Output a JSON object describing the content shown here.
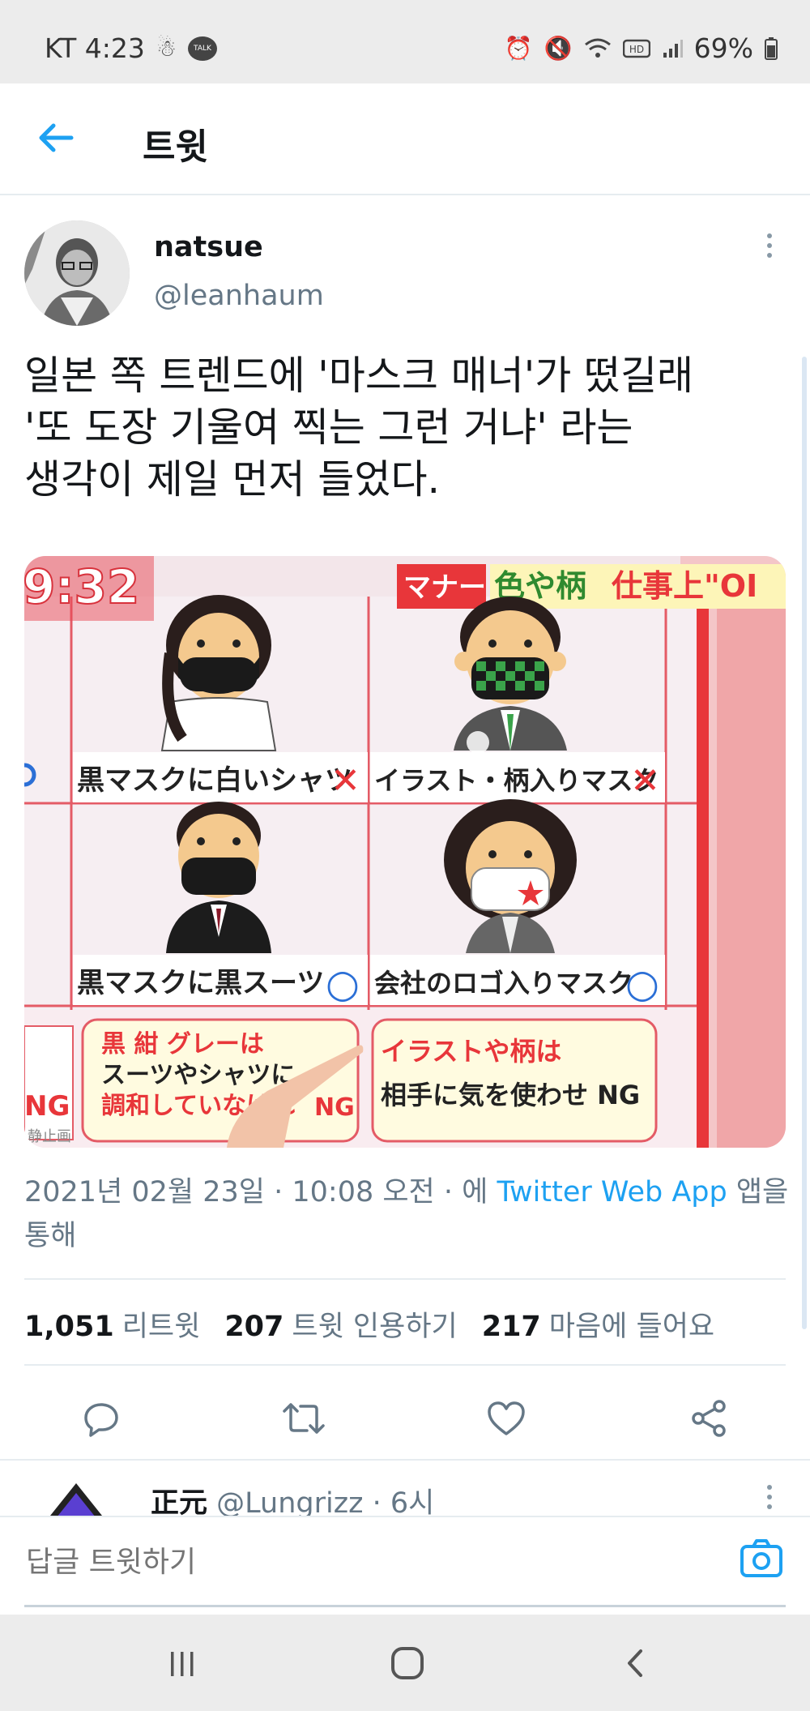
{
  "status_bar": {
    "carrier_time": "KT 4:23",
    "talk_label": "TALK",
    "battery": "69%"
  },
  "header": {
    "title": "트윗"
  },
  "tweet": {
    "author_name": "natsue",
    "author_handle": "@leanhaum",
    "text_lines": [
      "일본 쪽 트렌드에 '마스크 매너'가 떴길래",
      "'또 도장 기울여 찍는 그런 거냐' 라는",
      "생각이 제일 먼저 들었다."
    ],
    "meta_prefix": "2021년 02월 23일 · 10:08 오전 · 에 ",
    "meta_link": "Twitter Web App",
    "meta_suffix_1": " 앱을",
    "meta_suffix_2": "통해",
    "stats": {
      "retweets_count": "1,051",
      "retweets_label": "리트윗",
      "quotes_count": "207",
      "quotes_label": "트윗 인용하기",
      "likes_count": "217",
      "likes_label": "마음에 들어요"
    }
  },
  "media": {
    "clock": "9:32",
    "tag_manner": "マナー",
    "tag_color": "色や柄",
    "tag_work": "仕事上\"OI",
    "cells": [
      {
        "caption": "黒マスクに白いシャツ",
        "mark": "✕"
      },
      {
        "caption": "イラスト・柄入りマスク",
        "mark": "✕"
      },
      {
        "caption": "黒マスクに黒スーツ",
        "mark": "○"
      },
      {
        "caption": "会社のロゴ入りマスク",
        "mark": "○"
      }
    ],
    "bubble_left_line1": "黒 紺 グレーは",
    "bubble_left_line2": "スーツやシャツに",
    "bubble_left_line3": "調和していなけれ",
    "bubble_left_ng": "NG",
    "bubble_right_line1": "イラストや柄は",
    "bubble_right_line2": "相手に気を使わせ NG",
    "left_edge_ng": "NG",
    "still_label": "静止画"
  },
  "reply": {
    "name": "正元",
    "handle_time": " @Lungrizz · 6시"
  },
  "composer": {
    "placeholder": "답글 트윗하기"
  },
  "colors": {
    "accent": "#1da1f2",
    "text": "#14171a",
    "muted": "#657786"
  }
}
